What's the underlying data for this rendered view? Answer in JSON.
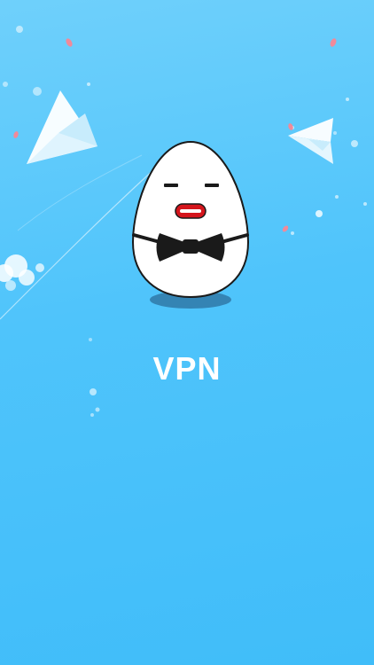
{
  "splash": {
    "app_name": "VPN",
    "mascot_icon": "egg-bowtie-mascot-icon",
    "decorations": [
      "paper-plane-icon",
      "paper-plane-icon",
      "bubble-icon",
      "petal-icon"
    ]
  },
  "colors": {
    "background_top": "#6fd0fb",
    "background_bottom": "#40bdf9",
    "text": "#ffffff",
    "mascot_body": "#ffffff",
    "mascot_outline": "#1a1a1a",
    "lips": "#d4151c",
    "petals": "#f08a9a"
  }
}
